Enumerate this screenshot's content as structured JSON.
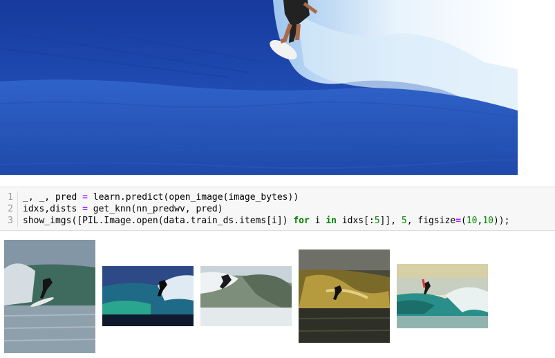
{
  "code_cell": {
    "line_numbers": [
      "1",
      "2",
      "3"
    ],
    "lines": [
      [
        {
          "t": "_, _, pred ",
          "c": ""
        },
        {
          "t": "=",
          "c": "op"
        },
        {
          "t": " learn.predict(open_image(image_bytes))",
          "c": ""
        }
      ],
      [
        {
          "t": "idxs,dists ",
          "c": ""
        },
        {
          "t": "=",
          "c": "op"
        },
        {
          "t": " get_knn(nn_predwv, pred)",
          "c": ""
        }
      ],
      [
        {
          "t": "show_imgs([PIL.Image.open(data.train_ds.items[i]) ",
          "c": ""
        },
        {
          "t": "for",
          "c": "kw"
        },
        {
          "t": " i ",
          "c": ""
        },
        {
          "t": "in",
          "c": "kw"
        },
        {
          "t": " idxs[:",
          "c": ""
        },
        {
          "t": "5",
          "c": "num"
        },
        {
          "t": "]], ",
          "c": ""
        },
        {
          "t": "5",
          "c": "num"
        },
        {
          "t": ", figsize",
          "c": ""
        },
        {
          "t": "=",
          "c": "op"
        },
        {
          "t": "(",
          "c": ""
        },
        {
          "t": "10",
          "c": "num"
        },
        {
          "t": ",",
          "c": ""
        },
        {
          "t": "10",
          "c": "num"
        },
        {
          "t": "));",
          "c": ""
        }
      ]
    ]
  },
  "colors": {
    "keyword": "#008000",
    "operator": "#aa22ff",
    "number": "#008800",
    "cell_background": "#f7f7f7"
  },
  "images": {
    "query": "surfer-on-large-blue-wave",
    "results": [
      "surfer-result-1",
      "surfer-result-2",
      "surfer-result-3",
      "surfer-result-4",
      "surfer-result-5"
    ]
  }
}
